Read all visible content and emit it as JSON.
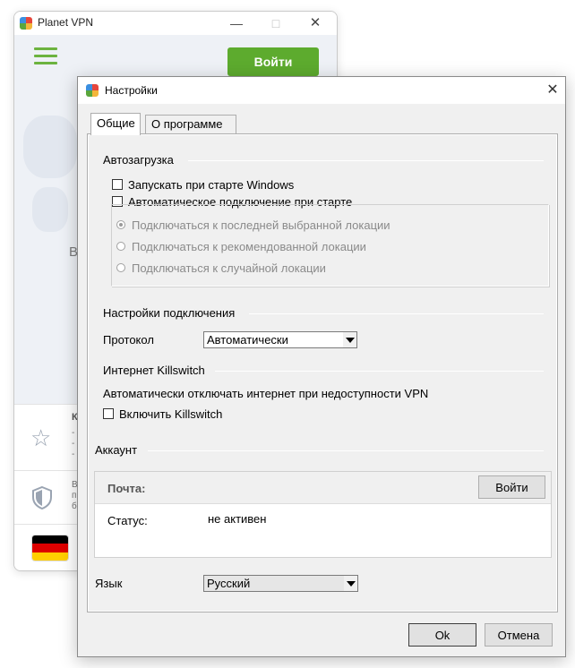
{
  "main_window": {
    "title": "Planet VPN",
    "login_button": "Войти",
    "peek_letter": "В",
    "list": {
      "row1_peek": "К\n-\n-\n-",
      "row2_peek": "В\nп\nб"
    },
    "flag_colors": [
      "#000000",
      "#dd0000",
      "#ffce00"
    ],
    "accent_color": "#5dab2e"
  },
  "dialog": {
    "title": "Настройки",
    "tabs": [
      {
        "label": "Общие",
        "active": true
      },
      {
        "label": "О программе",
        "active": false
      }
    ],
    "autoload": {
      "heading": "Автозагрузка",
      "start_with_windows": "Запускать при старте Windows",
      "auto_connect": "Автоматическое подключение при старте",
      "radio_options": [
        "Подключаться к последней выбранной локации",
        "Подключаться к рекомендованной локации",
        "Подключаться к случайной локации"
      ],
      "selected_radio": 0
    },
    "connection": {
      "heading": "Настройки подключения",
      "protocol_label": "Протокол",
      "protocol_value": "Автоматически"
    },
    "killswitch": {
      "heading": "Интернет Killswitch",
      "description": "Автоматически отключать интернет при недоступности VPN",
      "enable_label": "Включить Killswitch"
    },
    "account": {
      "heading": "Аккаунт",
      "email_label": "Почта:",
      "login_button": "Войти",
      "status_label": "Статус:",
      "status_value": "не активен"
    },
    "language": {
      "label": "Язык",
      "value": "Русский"
    },
    "ok_button": "Ok",
    "cancel_button": "Отмена"
  }
}
